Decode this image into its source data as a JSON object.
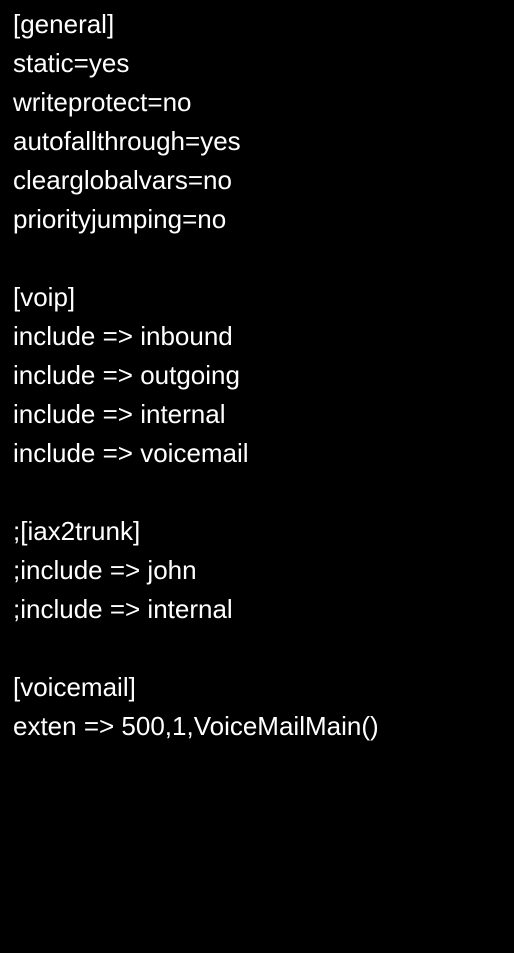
{
  "lines": [
    "[general]",
    "static=yes",
    "writeprotect=no",
    "autofallthrough=yes",
    "clearglobalvars=no",
    "priorityjumping=no",
    "",
    "[voip]",
    "include => inbound",
    "include => outgoing",
    "include => internal",
    "include => voicemail",
    "",
    ";[iax2trunk]",
    ";include => john",
    ";include => internal",
    "",
    "[voicemail]",
    "exten => 500,1,VoiceMailMain()"
  ]
}
